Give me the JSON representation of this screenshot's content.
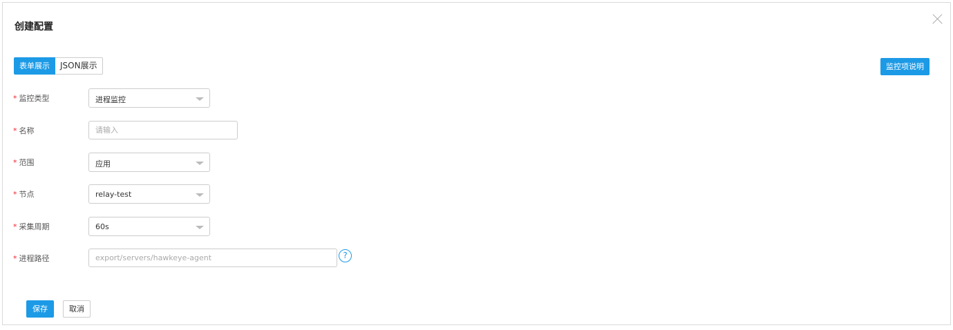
{
  "dialog": {
    "title": "创建配置",
    "tabs": [
      {
        "label": "表单展示",
        "active": true
      },
      {
        "label": "JSON展示",
        "active": false
      }
    ],
    "help_button_label": "监控项说明"
  },
  "form": {
    "required_mark": "*",
    "monitor_type": {
      "label": "监控类型",
      "value": "进程监控"
    },
    "name": {
      "label": "名称",
      "value": "",
      "placeholder": "请输入"
    },
    "scope": {
      "label": "范围",
      "value": "应用"
    },
    "node": {
      "label": "节点",
      "value": "relay-test"
    },
    "period": {
      "label": "采集周期",
      "value": "60s"
    },
    "process_path": {
      "label": "进程路径",
      "value": "",
      "placeholder": "export/servers/hawkeye-agent"
    },
    "help_icon_glyph": "?"
  },
  "footer": {
    "save_label": "保存",
    "cancel_label": "取消"
  },
  "colors": {
    "primary": "#1c9ae6",
    "required": "#f5222d",
    "border": "#cccccc"
  },
  "icons": [
    "close-icon",
    "chevron-down-icon",
    "question-circle-icon"
  ]
}
